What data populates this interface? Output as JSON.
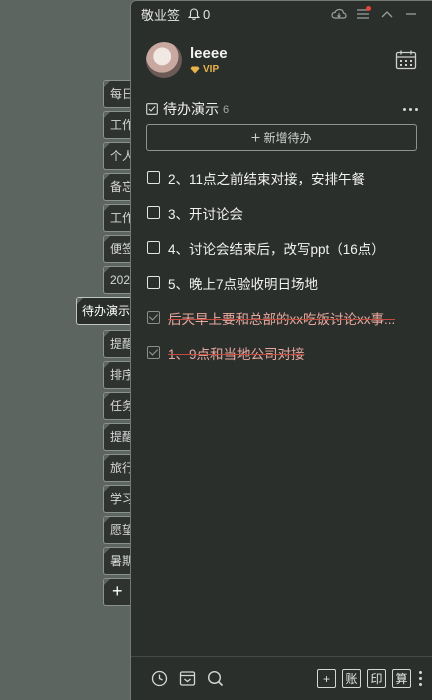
{
  "app": {
    "name": "敬业签",
    "bell_count": "0"
  },
  "profile": {
    "username": "leeee",
    "badge": "VIP"
  },
  "side_tabs": [
    {
      "label": "每日"
    },
    {
      "label": "工作"
    },
    {
      "label": "个人"
    },
    {
      "label": "备忘"
    },
    {
      "label": "工作"
    },
    {
      "label": "便签"
    },
    {
      "label": "202"
    },
    {
      "label": "待办演示",
      "active": true
    },
    {
      "label": "提醒"
    },
    {
      "label": "排序"
    },
    {
      "label": "任务"
    },
    {
      "label": "提醒"
    },
    {
      "label": "旅行"
    },
    {
      "label": "学习"
    },
    {
      "label": "愿望"
    },
    {
      "label": "暑期"
    }
  ],
  "add_tab_label": "+",
  "list": {
    "title": "待办演示",
    "count": "6",
    "add_label": "新增待办",
    "items": [
      {
        "text": "2、11点之前结束对接，安排午餐",
        "done": false
      },
      {
        "text": "3、开讨论会",
        "done": false
      },
      {
        "text": "4、讨论会结束后，改写ppt（16点）",
        "done": false
      },
      {
        "text": "5、晚上7点验收明日场地",
        "done": false
      },
      {
        "text": "后天早上要和总部的xx吃饭讨论xx事...",
        "done": true
      },
      {
        "text": "1、9点和当地公司对接",
        "done": true
      }
    ]
  },
  "footer": {
    "btn_add": "+",
    "btn_account": "账",
    "btn_print": "印",
    "btn_calc": "算"
  },
  "colors": {
    "panel_bg": "#2b2f2c",
    "desktop_bg": "#5d6560",
    "done_text": "#e7a8a0",
    "vip": "#e8b34a"
  }
}
